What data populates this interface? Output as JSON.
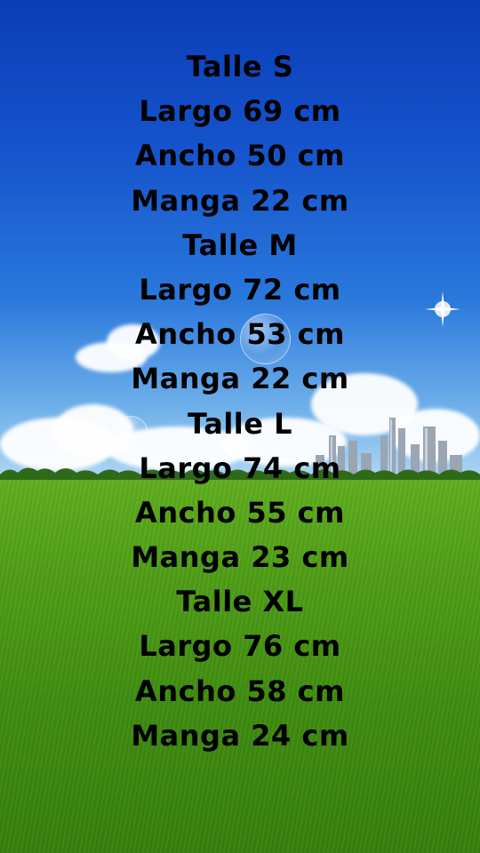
{
  "lines": [
    "Talle S",
    "Largo 69 cm",
    "Ancho 50 cm",
    "Manga 22 cm",
    "Talle M",
    "Largo 72 cm",
    "Ancho 53 cm",
    "Manga 22 cm",
    "Talle L",
    "Largo 74 cm",
    "Ancho 55 cm",
    "Manga 23 cm",
    "Talle XL",
    "Largo 76 cm",
    "Ancho 58 cm",
    "Manga 24 cm"
  ]
}
